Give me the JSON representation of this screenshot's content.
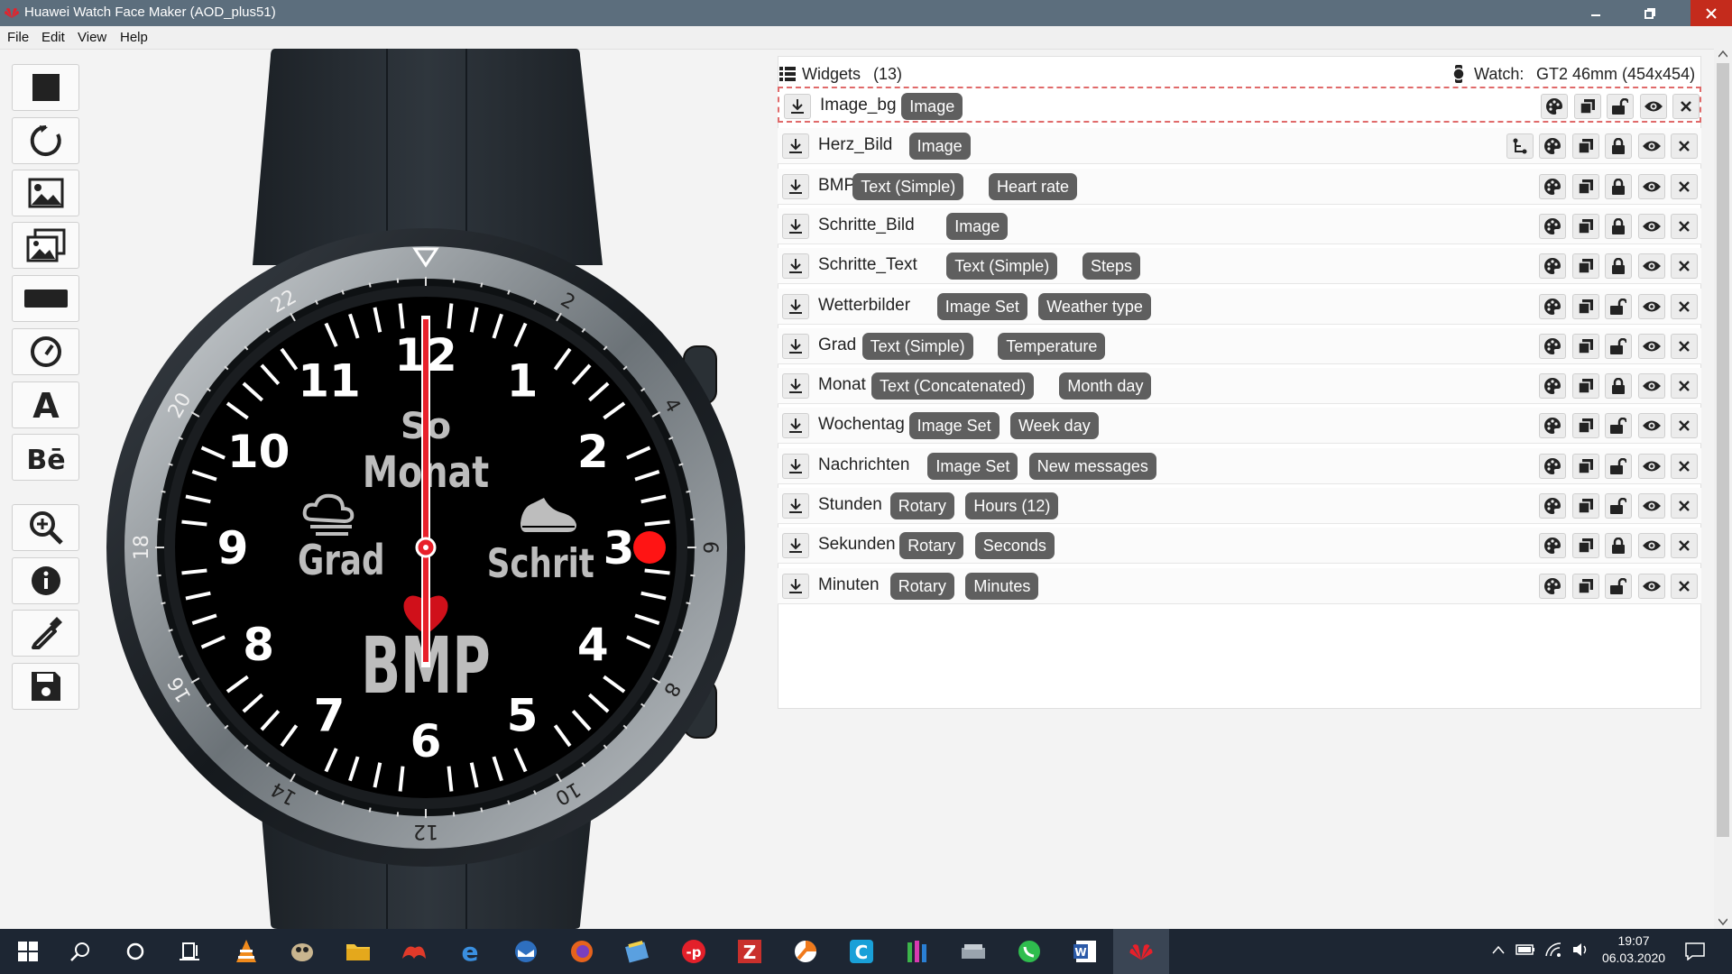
{
  "window": {
    "title": "Huawei Watch Face Maker (AOD_plus51)"
  },
  "menu": [
    "File",
    "Edit",
    "View",
    "Help"
  ],
  "watch_face": {
    "hour_numbers": [
      "12",
      "1",
      "2",
      "3",
      "4",
      "5",
      "6",
      "7",
      "8",
      "9",
      "10",
      "11"
    ],
    "bezel_numbers": [
      "2",
      "4",
      "6",
      "8",
      "10",
      "12",
      "14",
      "16",
      "18",
      "20",
      "22"
    ],
    "labels": {
      "monat": "Monat",
      "monat_top": "So",
      "grad": "Grad",
      "schritte": "Schritte",
      "bmp": "BMP"
    }
  },
  "widgets": {
    "title": "Widgets",
    "count": "(13)",
    "watch_label": "Watch:",
    "watch_model": "GT2 46mm (454x454)",
    "rows": [
      {
        "name": "Image_bg",
        "tags": [
          "Image"
        ],
        "lock": "unlock",
        "link": false,
        "selected": true
      },
      {
        "name": "Herz_Bild",
        "tags": [
          "Image"
        ],
        "lock": "lock",
        "link": true,
        "selected": false
      },
      {
        "name": "BMP",
        "tags": [
          "Text (Simple)",
          "Heart rate"
        ],
        "lock": "lock",
        "link": false,
        "selected": false
      },
      {
        "name": "Schritte_Bild",
        "tags": [
          "Image"
        ],
        "lock": "lock",
        "link": false,
        "selected": false
      },
      {
        "name": "Schritte_Text",
        "tags": [
          "Text (Simple)",
          "Steps"
        ],
        "lock": "lock",
        "link": false,
        "selected": false
      },
      {
        "name": "Wetterbilder",
        "tags": [
          "Image Set",
          "Weather type"
        ],
        "lock": "unlock",
        "link": false,
        "selected": false
      },
      {
        "name": "Grad",
        "tags": [
          "Text (Simple)",
          "Temperature"
        ],
        "lock": "unlock",
        "link": false,
        "selected": false
      },
      {
        "name": "Monat",
        "tags": [
          "Text (Concatenated)",
          "Month day"
        ],
        "lock": "lock",
        "link": false,
        "selected": false
      },
      {
        "name": "Wochentag",
        "tags": [
          "Image Set",
          "Week day"
        ],
        "lock": "unlock",
        "link": false,
        "selected": false
      },
      {
        "name": "Nachrichten",
        "tags": [
          "Image Set",
          "New messages"
        ],
        "lock": "unlock",
        "link": false,
        "selected": false
      },
      {
        "name": "Stunden",
        "tags": [
          "Rotary",
          "Hours (12)"
        ],
        "lock": "unlock",
        "link": false,
        "selected": false
      },
      {
        "name": "Sekunden",
        "tags": [
          "Rotary",
          "Seconds"
        ],
        "lock": "lock",
        "link": false,
        "selected": false
      },
      {
        "name": "Minuten",
        "tags": [
          "Rotary",
          "Minutes"
        ],
        "lock": "unlock",
        "link": false,
        "selected": false
      }
    ]
  },
  "taskbar": {
    "time": "19:07",
    "date": "06.03.2020"
  },
  "colors": {
    "accent_red": "#e8202a",
    "badge": "#5f5f5f",
    "titlebar": "#5c6e7d",
    "taskbar": "#1d2633"
  }
}
